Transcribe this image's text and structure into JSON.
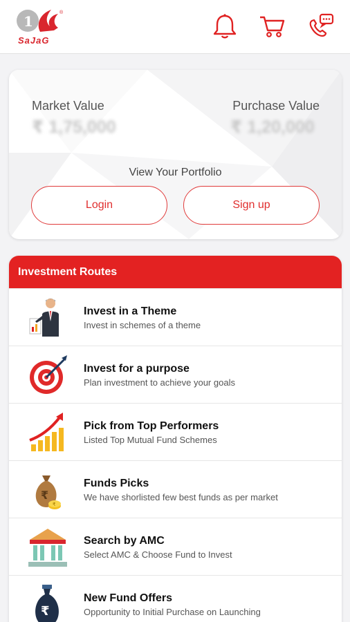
{
  "header": {
    "logo_text": "SaJaG",
    "icons": [
      "bell-icon",
      "cart-icon",
      "phone-chat-icon"
    ]
  },
  "portfolio": {
    "market_label": "Market Value",
    "market_value": "₹ 1,75,000",
    "purchase_label": "Purchase Value",
    "purchase_value": "₹ 1,20,000",
    "view_label": "View Your Portfolio",
    "login_label": "Login",
    "signup_label": "Sign up"
  },
  "routes": {
    "heading": "Investment Routes",
    "items": [
      {
        "title": "Invest in a Theme",
        "subtitle": "Invest in schemes of a theme",
        "icon": "businessman-presentation-icon"
      },
      {
        "title": "Invest for a purpose",
        "subtitle": "Plan investment to achieve your goals",
        "icon": "target-icon"
      },
      {
        "title": "Pick from Top Performers",
        "subtitle": "Listed Top Mutual Fund Schemes",
        "icon": "growth-chart-icon"
      },
      {
        "title": "Funds Picks",
        "subtitle": "We have shorlisted few best funds as per market",
        "icon": "money-bag-icon"
      },
      {
        "title": "Search by AMC",
        "subtitle": "Select AMC & Choose Fund to Invest",
        "icon": "bank-building-icon"
      },
      {
        "title": "New Fund Offers",
        "subtitle": "Opportunity to Initial Purchase on Launching",
        "icon": "fund-bag-icon"
      }
    ]
  },
  "colors": {
    "brand_red": "#e32222",
    "button_border": "#e03a3a"
  }
}
